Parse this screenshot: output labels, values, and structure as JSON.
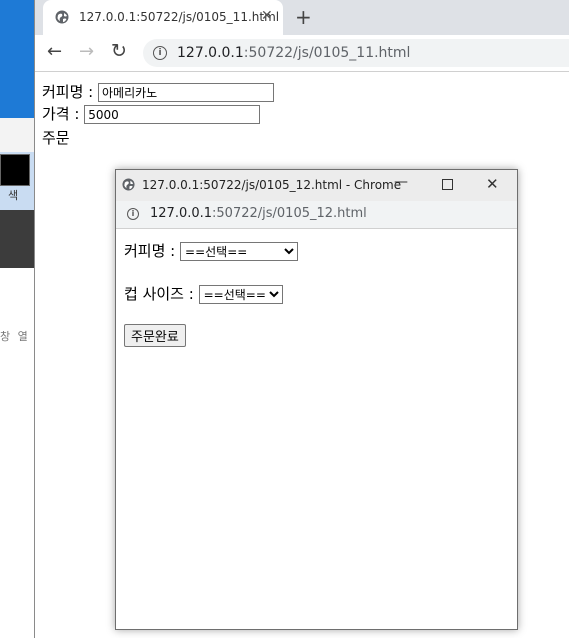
{
  "background_app": {
    "swatch_label": "색",
    "side_text": "창 열"
  },
  "browser": {
    "tab": {
      "title": "127.0.0.1:50722/js/0105_11.html",
      "close_glyph": "✕"
    },
    "new_tab_glyph": "+",
    "nav": {
      "back_glyph": "←",
      "forward_glyph": "→",
      "reload_glyph": "↻"
    },
    "address": {
      "host": "127.0.0.1",
      "path": ":50722/js/0105_11.html"
    }
  },
  "page": {
    "coffee_label": "커피명 :",
    "coffee_value": "아메리카노",
    "price_label": "가격 :",
    "price_value": "5000",
    "order_link": "주문"
  },
  "popup": {
    "title": "127.0.0.1:50722/js/0105_12.html - Chrome",
    "min_glyph": "—",
    "close_glyph": "✕",
    "address": {
      "host": "127.0.0.1",
      "path": ":50722/js/0105_12.html"
    },
    "coffee_label": "커피명 :",
    "coffee_select": "==선택==",
    "size_label": "컵 사이즈 :",
    "size_select": "==선택==",
    "submit_label": "주문완료"
  },
  "colors": {
    "taskbar_blue": "#1e7ad6",
    "tabstrip": "#dee1e6",
    "omnibox": "#f1f3f4"
  }
}
